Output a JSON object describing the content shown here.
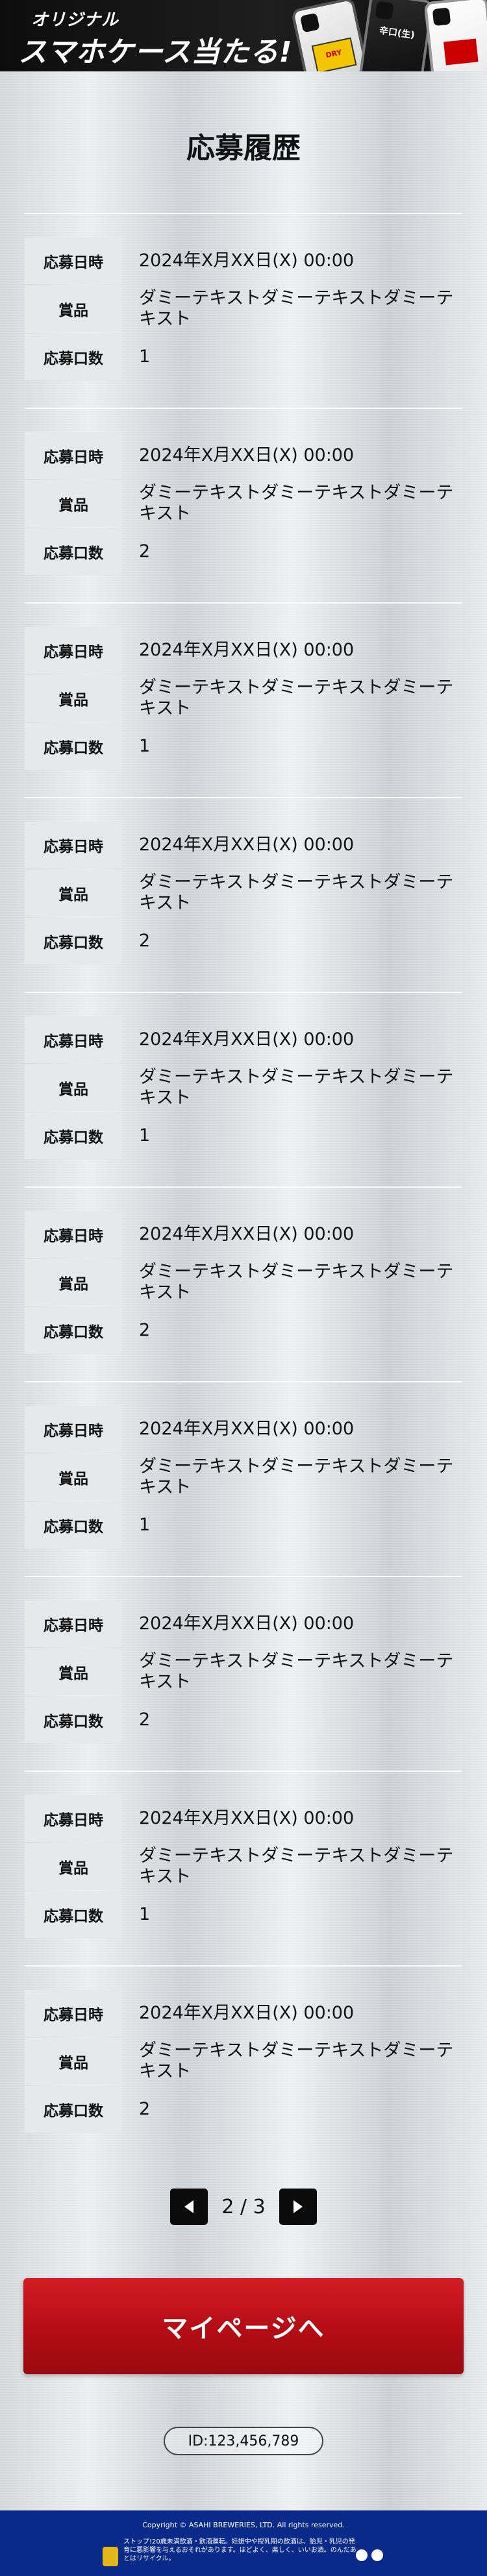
{
  "header": {
    "line1": "オリジナル",
    "line2": "スマホケース当たる!",
    "case_labels": {
      "yellow": "DRY",
      "black": "辛口(生)"
    }
  },
  "page_title": "応募履歴",
  "labels": {
    "date": "応募日時",
    "prize": "賞品",
    "count": "応募口数"
  },
  "entries": [
    {
      "date": "2024年X月XX日(X) 00:00",
      "prize": "ダミーテキストダミーテキストダミーテキスト",
      "count": "1"
    },
    {
      "date": "2024年X月XX日(X) 00:00",
      "prize": "ダミーテキストダミーテキストダミーテキスト",
      "count": "2"
    },
    {
      "date": "2024年X月XX日(X) 00:00",
      "prize": "ダミーテキストダミーテキストダミーテキスト",
      "count": "1"
    },
    {
      "date": "2024年X月XX日(X) 00:00",
      "prize": "ダミーテキストダミーテキストダミーテキスト",
      "count": "2"
    },
    {
      "date": "2024年X月XX日(X) 00:00",
      "prize": "ダミーテキストダミーテキストダミーテキスト",
      "count": "1"
    },
    {
      "date": "2024年X月XX日(X) 00:00",
      "prize": "ダミーテキストダミーテキストダミーテキスト",
      "count": "2"
    },
    {
      "date": "2024年X月XX日(X) 00:00",
      "prize": "ダミーテキストダミーテキストダミーテキスト",
      "count": "1"
    },
    {
      "date": "2024年X月XX日(X) 00:00",
      "prize": "ダミーテキストダミーテキストダミーテキスト",
      "count": "2"
    },
    {
      "date": "2024年X月XX日(X) 00:00",
      "prize": "ダミーテキストダミーテキストダミーテキスト",
      "count": "1"
    },
    {
      "date": "2024年X月XX日(X) 00:00",
      "prize": "ダミーテキストダミーテキストダミーテキスト",
      "count": "2"
    }
  ],
  "pagination": {
    "label": "2 / 3",
    "prev_icon": "triangle-left-icon",
    "next_icon": "triangle-right-icon"
  },
  "mypage_button": "マイページへ",
  "user_id": "ID:123,456,789",
  "footer": {
    "copyright": "Copyright © ASAHI BREWERIES, LTD. All rights reserved.",
    "notes": "ストップ!20歳未満飲酒・飲酒運転。妊娠中や授乳期の飲酒は、胎児・乳児の発育に悪影響を与えるおそれがあります。ほどよく、楽しく、いいお酒。のんだあとはリサイクル。",
    "bg_color": "#0a2a8a"
  },
  "colors": {
    "accent_red": "#c8141c",
    "pager_black": "#0b0b0b"
  }
}
